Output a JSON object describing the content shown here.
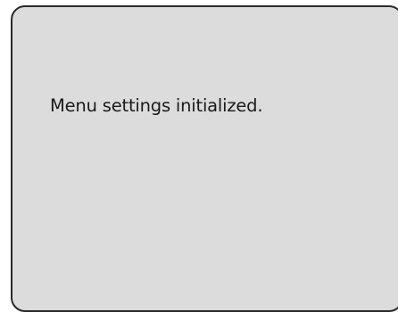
{
  "screen": {
    "message": "Menu settings initialized."
  }
}
